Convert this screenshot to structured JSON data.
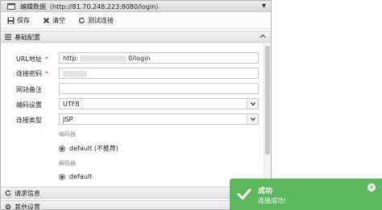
{
  "window": {
    "title": "编辑数据（http://81.70.248.223:8080/login）",
    "close_glyph": "▾"
  },
  "toolbar": {
    "save_label": "保存",
    "clear_label": "清空",
    "test_label": "测试连接"
  },
  "sections": {
    "basic": "基础配置",
    "request": "请求信息",
    "other": "其他设置"
  },
  "form": {
    "url_label": "URL地址",
    "url_prefix": "http:",
    "url_suffix": "0/login",
    "password_label": "连接密码",
    "note_label": "网站备注",
    "encoding_label": "编码设置",
    "encoding_value": "UTF8",
    "type_label": "连接类型",
    "type_value": "JSP",
    "encoder_caption": "编码器",
    "encoder_option": "default (不推荐)",
    "decoder_caption": "解码器",
    "decoder_option": "default",
    "required_mark": "*"
  },
  "toast": {
    "title": "成功",
    "message": "连接成功!",
    "color": "#5cb85c"
  }
}
